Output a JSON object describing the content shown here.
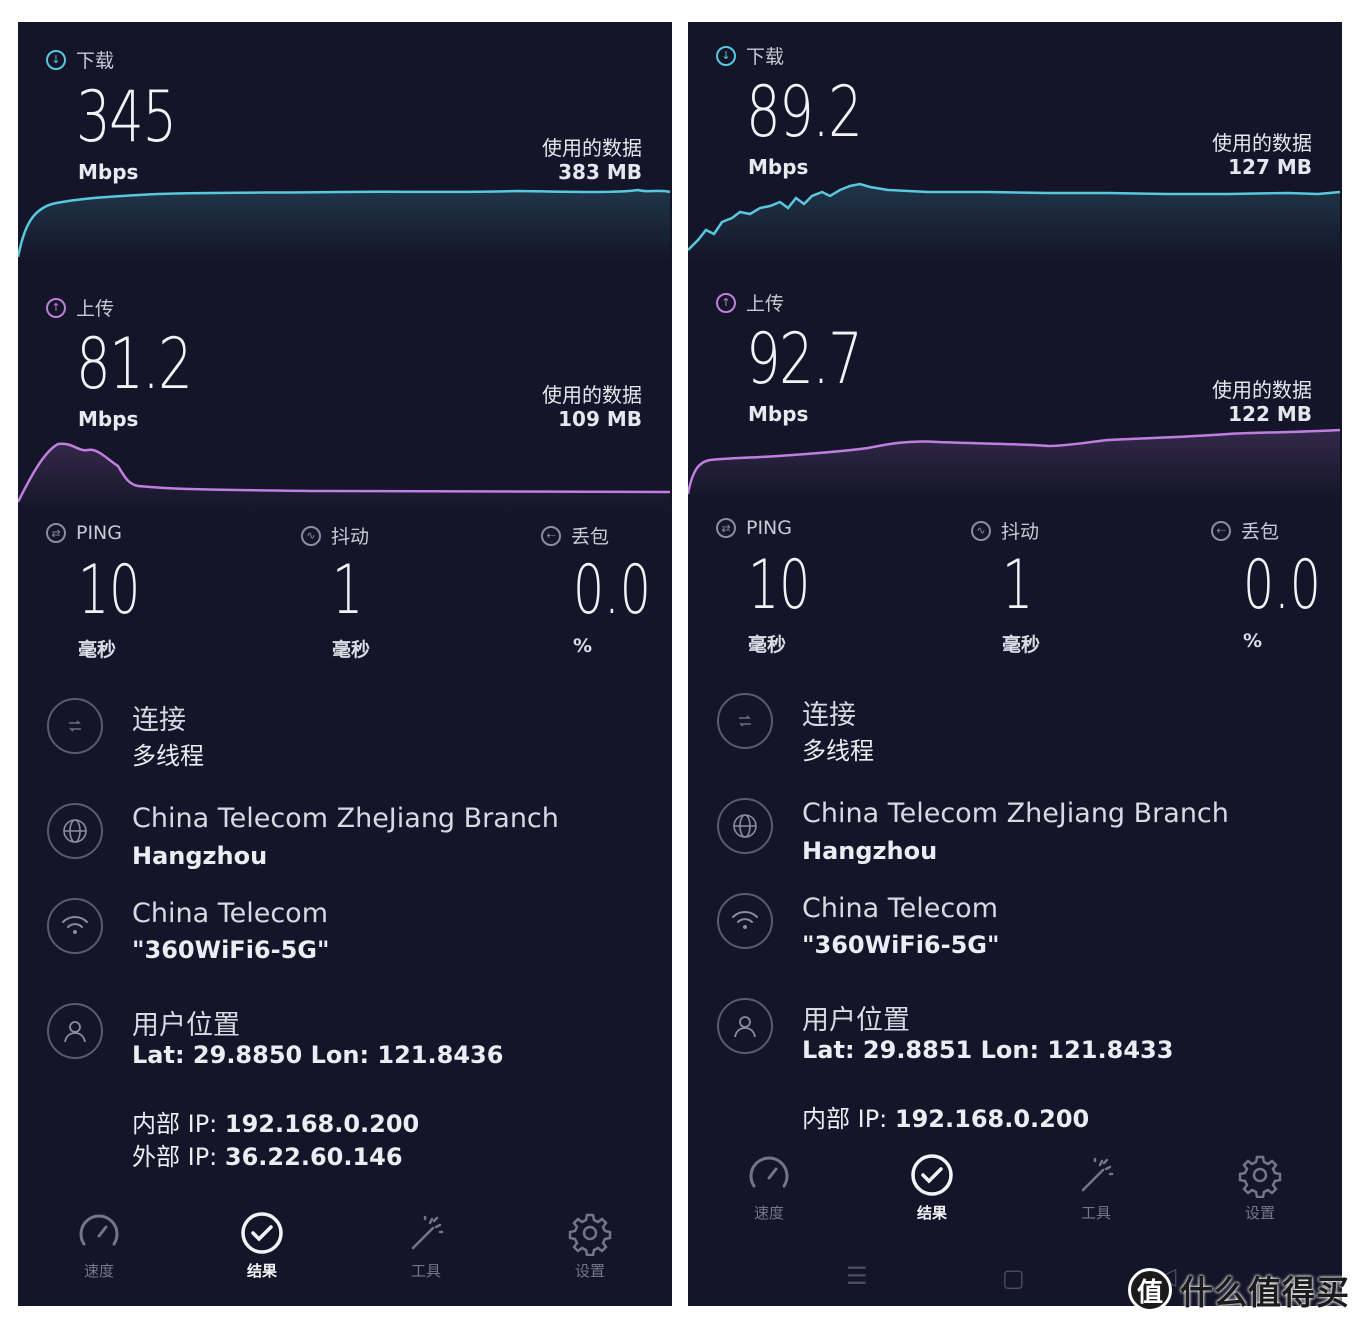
{
  "panels": [
    {
      "download": {
        "label": "下载",
        "value": "345",
        "unit": "Mbps",
        "used_label": "使用的数据",
        "used_value": "383 MB"
      },
      "upload": {
        "label": "上传",
        "value": "81.2",
        "unit": "Mbps",
        "used_label": "使用的数据",
        "used_value": "109 MB"
      },
      "ping": {
        "label": "PING",
        "value": "10",
        "unit": "毫秒"
      },
      "jitter": {
        "label": "抖动",
        "value": "1",
        "unit": "毫秒"
      },
      "loss": {
        "label": "丢包",
        "value": "0.0",
        "unit": "%"
      },
      "connection": {
        "title": "连接",
        "sub": "多线程"
      },
      "server": {
        "title": "China Telecom ZheJiang Branch",
        "sub": "Hangzhou"
      },
      "network": {
        "title": "China Telecom",
        "sub": "\"360WiFi6-5G\""
      },
      "location": {
        "title": "用户位置",
        "sub": "Lat: 29.8850 Lon: 121.8436"
      },
      "internal_ip": {
        "label": "内部 IP: ",
        "value": "192.168.0.200"
      },
      "external_ip": {
        "label": "外部 IP: ",
        "value": "36.22.60.146"
      },
      "nav": {
        "speed": "速度",
        "results": "结果",
        "tools": "工具",
        "settings": "设置"
      }
    },
    {
      "download": {
        "label": "下载",
        "value": "89.2",
        "unit": "Mbps",
        "used_label": "使用的数据",
        "used_value": "127 MB"
      },
      "upload": {
        "label": "上传",
        "value": "92.7",
        "unit": "Mbps",
        "used_label": "使用的数据",
        "used_value": "122 MB"
      },
      "ping": {
        "label": "PING",
        "value": "10",
        "unit": "毫秒"
      },
      "jitter": {
        "label": "抖动",
        "value": "1",
        "unit": "毫秒"
      },
      "loss": {
        "label": "丢包",
        "value": "0.0",
        "unit": "%"
      },
      "connection": {
        "title": "连接",
        "sub": "多线程"
      },
      "server": {
        "title": "China Telecom ZheJiang Branch",
        "sub": "Hangzhou"
      },
      "network": {
        "title": "China Telecom",
        "sub": "\"360WiFi6-5G\""
      },
      "location": {
        "title": "用户位置",
        "sub": "Lat: 29.8851 Lon: 121.8433"
      },
      "internal_ip": {
        "label": "内部 IP: ",
        "value": "192.168.0.200"
      },
      "nav": {
        "speed": "速度",
        "results": "结果",
        "tools": "工具",
        "settings": "设置"
      }
    }
  ],
  "watermark": {
    "text": "什么值得买",
    "logo_char": "值"
  },
  "colors": {
    "background": "#141528",
    "download": "#57c8de",
    "upload": "#c07fe0"
  },
  "icons": [
    "download-icon",
    "upload-icon",
    "ping-icon",
    "jitter-icon",
    "loss-icon",
    "connection-icon",
    "globe-icon",
    "wifi-icon",
    "user-icon",
    "speedometer-icon",
    "check-circle-icon",
    "magic-wand-icon",
    "gear-icon"
  ]
}
